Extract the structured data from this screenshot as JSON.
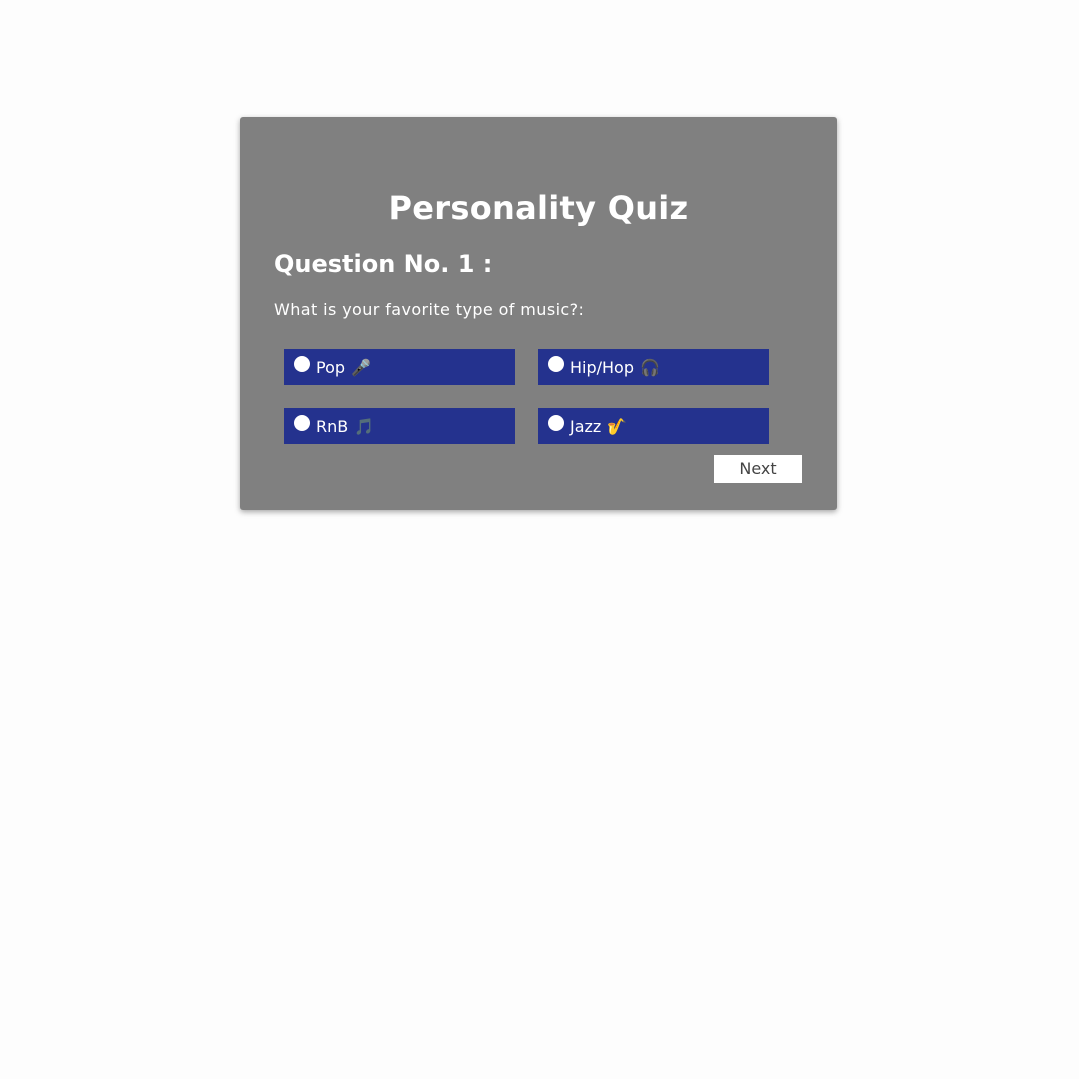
{
  "quiz": {
    "title": "Personality Quiz",
    "question_number": "Question No. 1 :",
    "question_text": "What is your favorite type of music?:",
    "options": [
      {
        "label": "Pop",
        "emoji": "🎤"
      },
      {
        "label": "Hip/Hop",
        "emoji": "🎧"
      },
      {
        "label": "RnB",
        "emoji": "🎵"
      },
      {
        "label": "Jazz",
        "emoji": "🎷"
      }
    ],
    "next_label": "Next"
  },
  "colors": {
    "card_background": "#808080",
    "option_background": "#24328e",
    "page_background": "#fdfdfd"
  }
}
